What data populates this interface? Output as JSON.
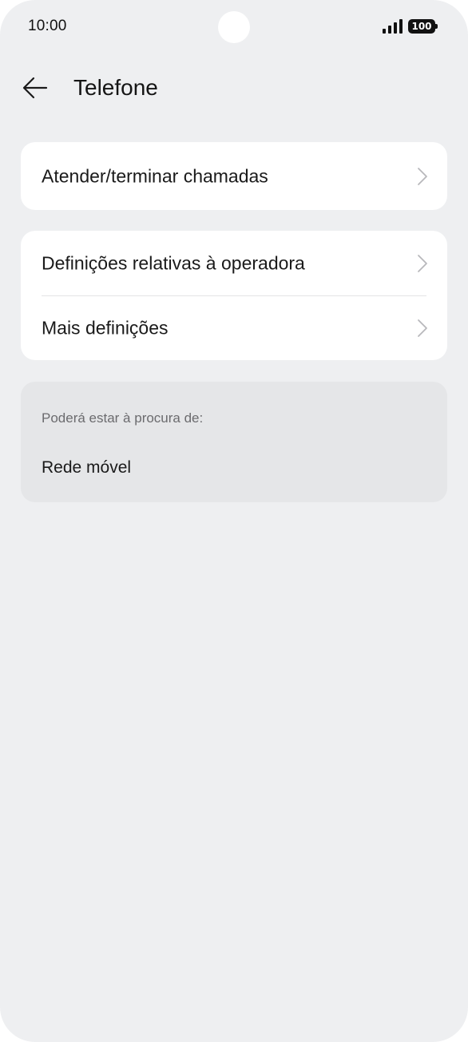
{
  "status_bar": {
    "time": "10:00",
    "battery_level": "100",
    "signal_icon": "signal-bars-icon"
  },
  "header": {
    "back_icon": "arrow-left-icon",
    "title": "Telefone"
  },
  "settings_groups": [
    {
      "items": [
        {
          "label": "Atender/terminar chamadas",
          "icon": "chevron-right-icon"
        }
      ]
    },
    {
      "items": [
        {
          "label": "Definições relativas à operadora",
          "icon": "chevron-right-icon"
        },
        {
          "label": "Mais definições",
          "icon": "chevron-right-icon"
        }
      ]
    }
  ],
  "suggestions": {
    "caption": "Poderá estar à procura de:",
    "items": [
      {
        "label": "Rede móvel"
      }
    ]
  },
  "colors": {
    "background": "#eeeff1",
    "card": "#ffffff",
    "suggestion_card": "#e5e6e8",
    "text_primary": "#1a1a1a",
    "text_secondary": "#6b6b6e",
    "chevron": "#b8b8bb"
  }
}
